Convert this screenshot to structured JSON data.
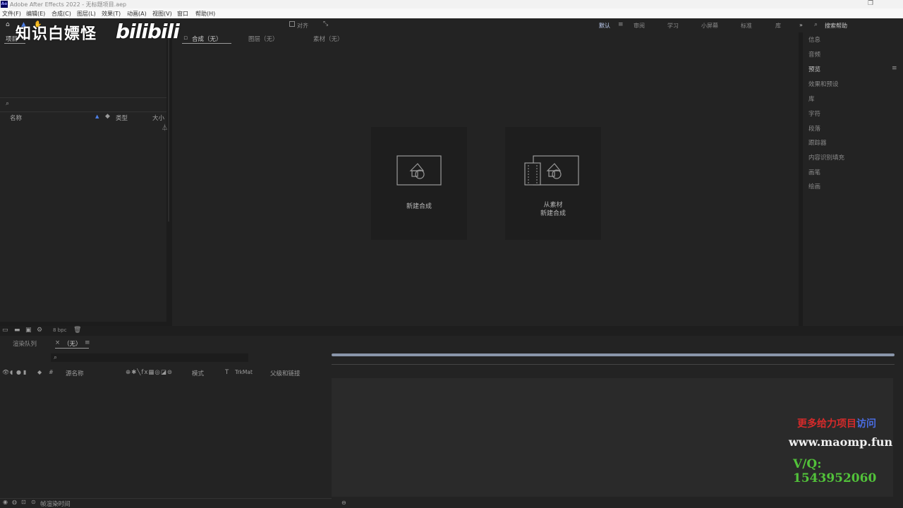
{
  "app": {
    "title": "Adobe After Effects 2022 - 无标题项目.aep",
    "logo": "Ae"
  },
  "window_controls": {
    "restore": "❐"
  },
  "menubar": [
    "文件(F)",
    "编辑(E)",
    "合成(C)",
    "图层(L)",
    "效果(T)",
    "动画(A)",
    "视图(V)",
    "窗口",
    "帮助(H)"
  ],
  "toolbar": {
    "snap_label": "对齐",
    "workspaces": [
      "默认",
      "审阅",
      "学习",
      "小屏幕",
      "标准",
      "库"
    ],
    "active_workspace": "默认",
    "more": "»",
    "search_help": "搜索帮助"
  },
  "project_panel": {
    "tab": "项目",
    "columns": {
      "name": "名称",
      "type": "类型",
      "size": "大小"
    }
  },
  "comp_panel": {
    "tabs": [
      "合成（无）",
      "图层（无）",
      "素材（无）"
    ],
    "active_tab": "合成（无）",
    "card_new": "新建合成",
    "card_from_footage_line1": "从素材",
    "card_from_footage_line2": "新建合成"
  },
  "right_panel": {
    "items": [
      "信息",
      "音频",
      "预览",
      "效果和预设",
      "库",
      "字符",
      "段落",
      "跟踪器",
      "内容识别填充",
      "画笔",
      "绘画"
    ],
    "active_item": "预览"
  },
  "project_footer": {
    "bpc": "8 bpc"
  },
  "timeline": {
    "tabs": [
      "渲染队列",
      "（无）"
    ],
    "columns": {
      "source_name": "源名称",
      "mode": "模式",
      "trkmat": "TrkMat",
      "parent": "父级和链接"
    },
    "footer_label": "帧渲染时间"
  },
  "watermark": {
    "channel": "知识白嫖怪",
    "platform": "bilibili",
    "more_red": "更多给力项目",
    "more_blue": "访问",
    "url": "www.maomp.fun",
    "qq": "V/Q:  1543952060"
  },
  "colors": {
    "panel_bg": "#232323",
    "accent_blue": "#4d7fe6",
    "watermark_red": "#d62a2a",
    "watermark_green": "#52c23a"
  }
}
